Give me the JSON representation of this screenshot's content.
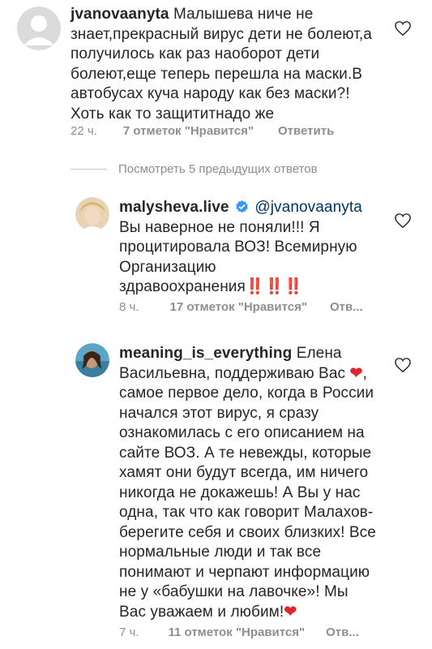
{
  "comments": [
    {
      "username": "jvanovaanyta",
      "mention": "",
      "text": "Малышева ниче не знает,прекрасный вирус дети не болеют,а получилось как раз наоборот дети болеют,еще теперь перешла на маски.В автобусах куча народу как без маски?! Хоть как то защититнадо же",
      "time": "22 ч.",
      "likes": "7 отметок \"Нравится\"",
      "reply": "Ответить"
    },
    {
      "username": "malysheva.live",
      "verified": true,
      "mention": "@jvanovaanyta",
      "text": "Вы наверное не поняли!!! Я процитировала ВОЗ! Всемирную Организацию здравоохранения",
      "emoji": "‼️‼️‼️",
      "time": "8 ч.",
      "likes": "17 отметок \"Нравится\"",
      "reply": "Отв..."
    },
    {
      "username": "meaning_is_everything",
      "mention": "",
      "text_part1": "Елена Васильевна, поддерживаю Вас",
      "text_part2": ", самое первое дело, когда в России начался этот вирус, я сразу ознакомилась с его описанием на сайте ВОЗ. А те невежды, которые хамят они будут всегда, им ничего никогда не докажешь!  А Вы у нас одна, так что как говорит Малахов-берегите себя и своих близких! Все нормальные люди и так все понимают и черпают информацию не у «бабушки на лавочке»! Мы Вас уважаем и любим!",
      "heart_emoji": "❤",
      "time": "7 ч.",
      "likes": "11 отметок \"Нравится\"",
      "reply": "Отв..."
    }
  ],
  "view_replies": "Посмотреть 5 предыдущих ответов",
  "colors": {
    "text": "#262626",
    "muted": "#8e8e8e",
    "mention": "#003569",
    "verified": "#3897f0",
    "heart_red": "#e0242b"
  }
}
